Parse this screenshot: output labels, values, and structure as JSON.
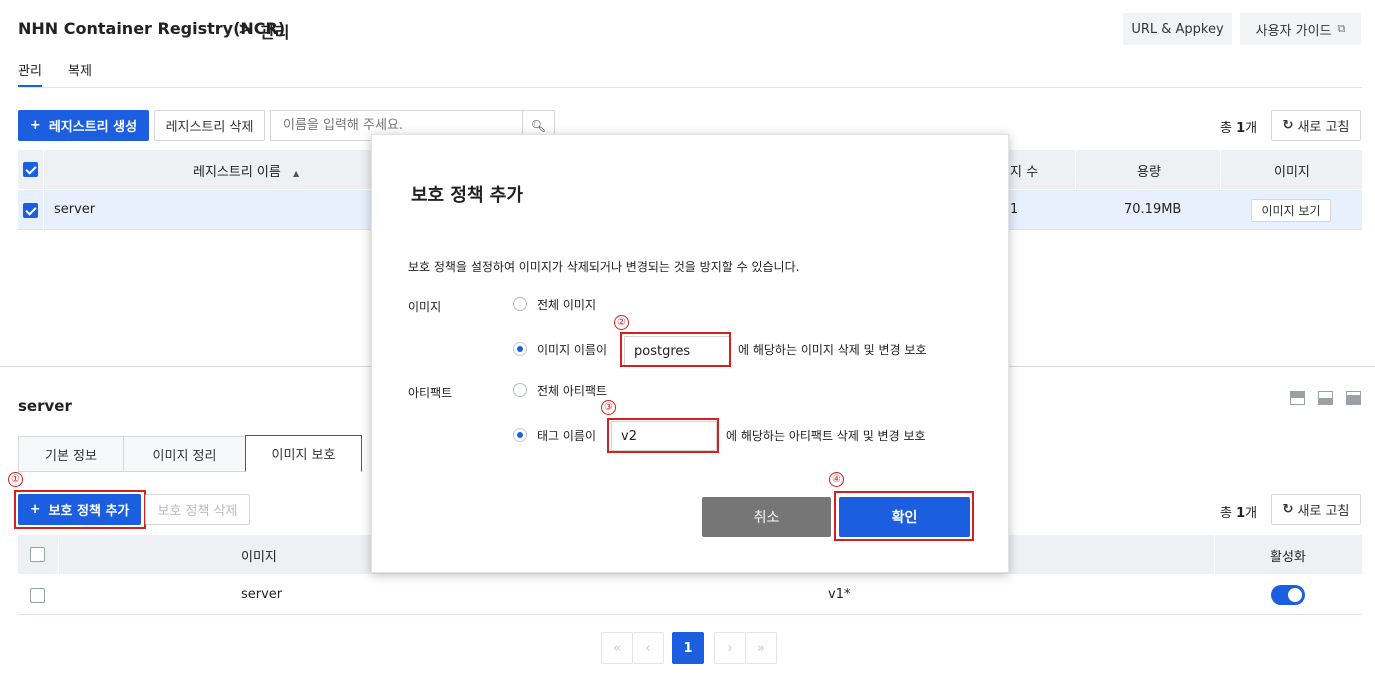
{
  "header": {
    "service": "NHN Container Registry(NCR)",
    "separator": ">",
    "current": "관리",
    "url_appkey": "URL & Appkey",
    "user_guide": "사용자 가이드"
  },
  "tabs": [
    "관리",
    "복제"
  ],
  "toolbar": {
    "create": "레지스트리 생성",
    "delete": "레지스트리 삭제",
    "search_placeholder": "이름을 입력해 주세요.",
    "total_prefix": "총",
    "total_count": "1",
    "total_suffix": "개",
    "refresh": "새로 고침"
  },
  "registry_table": {
    "headers": {
      "name": "레지스트리 이름",
      "count": "지 수",
      "size": "용량",
      "image": "이미지"
    },
    "row": {
      "name": "server",
      "count": "1",
      "size": "70.19MB",
      "view": "이미지 보기"
    }
  },
  "detail": {
    "title": "server",
    "tabs": [
      "기본 정보",
      "이미지 정리",
      "이미지 보호"
    ],
    "add_policy": "보호 정책 추가",
    "delete_policy": "보호 정책 삭제",
    "total_prefix": "총",
    "total_count": "1",
    "total_suffix": "개",
    "refresh": "새로 고침",
    "headers": {
      "image": "이미지",
      "active": "활성화"
    },
    "row": {
      "image": "server",
      "tag": "v1*",
      "active": true
    }
  },
  "pagination": {
    "current": "1"
  },
  "modal": {
    "title": "보호 정책 추가",
    "description": "보호 정책을 설정하여 이미지가 삭제되거나 변경되는 것을 방지할 수 있습니다.",
    "image_label": "이미지",
    "image_all": "전체 이미지",
    "image_name": "이미지 이름이",
    "image_value": "postgres",
    "image_suffix": "에 해당하는 이미지 삭제 및 변경 보호",
    "artifact_label": "아티팩트",
    "artifact_all": "전체 아티팩트",
    "tag_name": "태그 이름이",
    "tag_value": "v2",
    "tag_suffix": "에 해당하는 아티팩트 삭제 및 변경 보호",
    "cancel": "취소",
    "confirm": "확인"
  },
  "annotations": [
    "①",
    "②",
    "③",
    "④"
  ],
  "colors": {
    "primary": "#1b5fe0",
    "highlight": "#d32020",
    "cancel": "#767676"
  }
}
